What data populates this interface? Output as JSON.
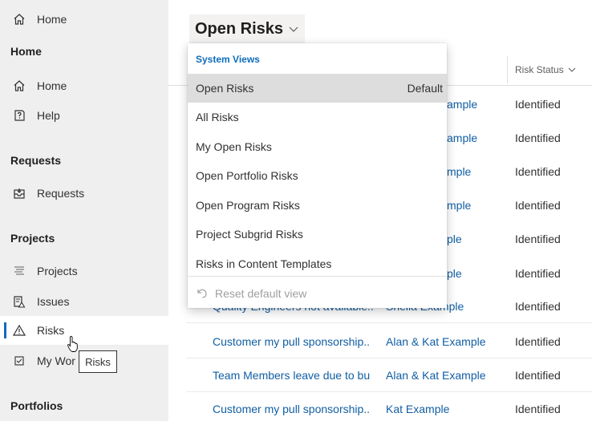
{
  "sidebar": {
    "top_item": {
      "label": "Home",
      "icon": "home-icon"
    },
    "sections": [
      {
        "label": "Home"
      },
      {
        "label": "Requests"
      },
      {
        "label": "Projects"
      },
      {
        "label": "Portfolios"
      }
    ],
    "items": [
      {
        "label": "Home",
        "icon": "home-icon"
      },
      {
        "label": "Help",
        "icon": "help-icon"
      },
      {
        "label": "Requests",
        "icon": "inbox-icon"
      },
      {
        "label": "Projects",
        "icon": "project-list-icon"
      },
      {
        "label": "Issues",
        "icon": "issues-icon"
      },
      {
        "label": "Risks",
        "icon": "warning-icon",
        "active": true
      },
      {
        "label": "My Wor",
        "icon": "checkbox-icon"
      }
    ],
    "tooltip": "Risks"
  },
  "main": {
    "view_selector": {
      "label": "Open Risks"
    },
    "column_headers": {
      "risk_status": "Risk Status"
    },
    "visible_fragments": [
      {
        "owner": "ample",
        "status": "Identified"
      },
      {
        "owner": "ample",
        "status": "Identified"
      },
      {
        "owner": "mple",
        "status": "Identified"
      },
      {
        "owner": "mple",
        "status": "Identified"
      },
      {
        "owner": "ple",
        "status": "Identified"
      },
      {
        "owner": "ple",
        "status": "Identified"
      }
    ],
    "rows": [
      {
        "title": "Quality Engineers not available..",
        "owner": "Sheila Example",
        "status": "Identified"
      },
      {
        "title": "Customer my pull sponsorship..",
        "owner": "Alan & Kat Example",
        "status": "Identified"
      },
      {
        "title": "Team Members leave due to bu",
        "owner": "Alan & Kat Example",
        "status": "Identified"
      },
      {
        "title": "Customer my pull sponsorship..",
        "owner": "Kat Example",
        "status": "Identified"
      }
    ]
  },
  "dropdown": {
    "header": "System Views",
    "items": [
      {
        "label": "Open Risks",
        "badge": "Default",
        "selected": true
      },
      {
        "label": "All Risks"
      },
      {
        "label": "My Open Risks"
      },
      {
        "label": "Open Portfolio Risks"
      },
      {
        "label": "Open Program Risks"
      },
      {
        "label": "Project Subgrid Risks"
      },
      {
        "label": "Risks in Content Templates"
      }
    ],
    "reset_label": "Reset default view"
  },
  "colors": {
    "accent": "#0f6cbd",
    "link": "#115ea3",
    "sidebar_bg": "#efefef"
  }
}
